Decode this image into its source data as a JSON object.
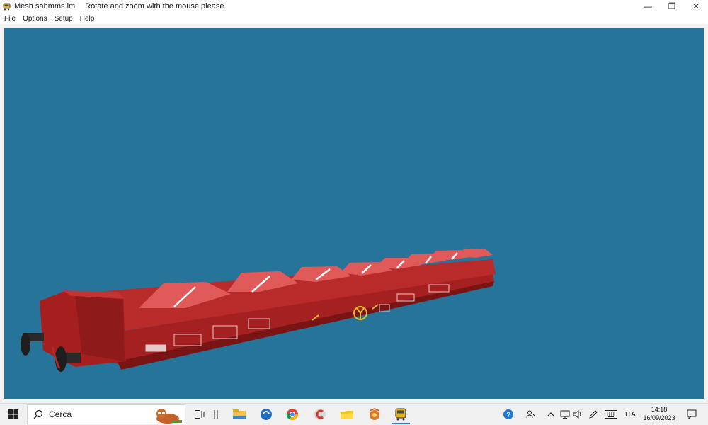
{
  "window": {
    "title": "Mesh sahmms.im",
    "hint": "Rotate and zoom with the mouse please.",
    "controls": {
      "minimize_glyph": "—",
      "restore_glyph": "❐",
      "close_glyph": "✕"
    }
  },
  "menu": [
    {
      "label": "File"
    },
    {
      "label": "Options"
    },
    {
      "label": "Setup"
    },
    {
      "label": "Help"
    }
  ],
  "viewport": {
    "background": "#26749a",
    "model": "railway flat wagon (red)",
    "model_color": "#b32727"
  },
  "taskbar": {
    "search_placeholder": "Cerca",
    "pinned": [
      "task-view-icon",
      "file-explorer-icon",
      "edge-like-icon",
      "chrome-icon",
      "ccleaner-icon",
      "folder-icon",
      "photo-app-icon",
      "train-app-icon"
    ],
    "tray": {
      "language": "ITA",
      "time": "14:18",
      "date": "16/09/2023"
    }
  }
}
